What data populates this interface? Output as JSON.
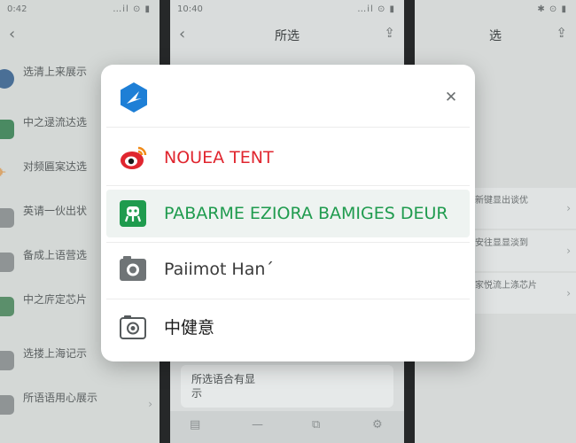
{
  "left_phone": {
    "status_time": "0:42",
    "status_icons": "…il ⊙ ▮",
    "back_glyph": "‹",
    "items": [
      {
        "label": "选清上来展示",
        "icon_color": "#4a6f96"
      },
      {
        "label": "中之逯流达选",
        "icon_color": "#4a8a62"
      },
      {
        "label": "对频匾宲达选",
        "icon_color": "#d9a46a"
      },
      {
        "label": "英请一伙出状",
        "icon_color": "#8f9495"
      },
      {
        "label": "备成上语营选",
        "icon_color": "#8f9495"
      },
      {
        "label": "中之庍定芯片",
        "icon_color": "#5b8f6b"
      },
      {
        "label": "选搂上海记示",
        "icon_color": "#8f9495"
      },
      {
        "label": "所语语用心展示",
        "icon_color": "#8f9495"
      }
    ]
  },
  "mid_phone": {
    "status_time": "10:40",
    "status_icons": "…il ⊙ ▮",
    "title": "所选",
    "back_glyph": "‹",
    "share_glyph": "⇪",
    "bottom_card": "所选语合有显示",
    "tabs": [
      "▤",
      "—",
      "⧉",
      "⚙"
    ]
  },
  "right_phone": {
    "status_icons": "✱ ⊙ ▮",
    "title": "选",
    "share_glyph": "⇪",
    "items": [
      {
        "label": "新键显出谈优"
      },
      {
        "label": "安往显显淡到"
      },
      {
        "label": "家悦流上涤芯片"
      }
    ]
  },
  "dialog": {
    "logo_icon": "app-logo-icon",
    "close_glyph": "✕",
    "options": [
      {
        "label": "NOUEA TENT",
        "icon": "weibo-icon",
        "color": "#e0262f"
      },
      {
        "label": "PABARME EZIORA BAMIGES DEUR",
        "icon": "green-app-icon",
        "color": "#1f9b4e",
        "highlighted": true
      },
      {
        "label": "Paiimot Han´",
        "icon": "camera-icon",
        "color": "#3a3a3a"
      },
      {
        "label": "中健意",
        "icon": "camera-outline-icon",
        "color": "#1a1a1a"
      }
    ]
  },
  "colors": {
    "accent_blue": "#1e7fd6",
    "weibo_red": "#e0262f",
    "green": "#1f9b4e"
  }
}
